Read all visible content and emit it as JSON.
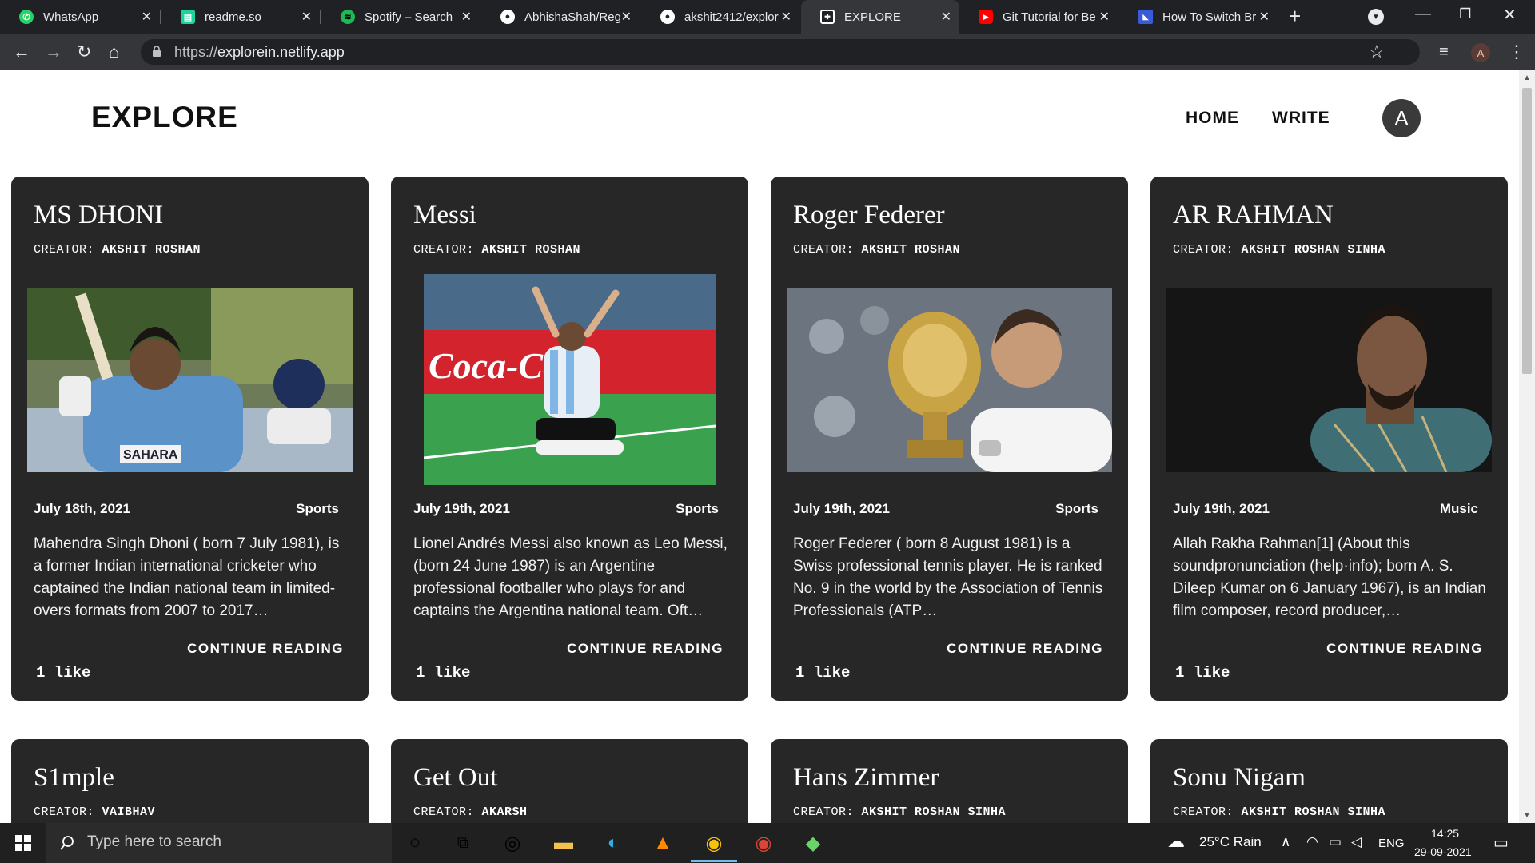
{
  "browser": {
    "tabs": [
      {
        "label": "WhatsApp",
        "icon": "whatsapp-icon",
        "color": "#25d366"
      },
      {
        "label": "readme.so",
        "icon": "readme-icon",
        "color": "#1fd29b"
      },
      {
        "label": "Spotify – Search",
        "icon": "spotify-icon",
        "color": "#1db954"
      },
      {
        "label": "AbhishaShah/Reg",
        "icon": "github-icon",
        "color": "#ffffff"
      },
      {
        "label": "akshit2412/explor",
        "icon": "github-icon",
        "color": "#ffffff"
      },
      {
        "label": "EXPLORE",
        "icon": "explore-icon",
        "color": "#ffffff"
      },
      {
        "label": "Git Tutorial for Be",
        "icon": "youtube-icon",
        "color": "#ff0000"
      },
      {
        "label": "How To Switch Br",
        "icon": "article-icon",
        "color": "#3a5bd9"
      }
    ],
    "url_scheme": "https://",
    "url_host": "explorein.netlify.app",
    "profile_initial": "A"
  },
  "site": {
    "brand": "EXPLORE",
    "nav": {
      "home": "HOME",
      "write": "WRITE"
    },
    "avatar_initial": "A"
  },
  "labels": {
    "creator_prefix": "CREATOR:",
    "continue": "CONTINUE READING"
  },
  "posts": [
    {
      "title": "MS DHONI",
      "creator": "AKSHIT ROSHAN",
      "date": "July 18th, 2021",
      "category": "Sports",
      "excerpt": "Mahendra Singh Dhoni ( born 7 July 1981), is a former Indian international cricketer who captained the Indian national team in limited-overs formats from 2007 to 2017…",
      "likes": "1 like",
      "jersey_text": "SAHARA"
    },
    {
      "title": "Messi",
      "creator": "AKSHIT ROSHAN",
      "date": "July 19th, 2021",
      "category": "Sports",
      "excerpt": "Lionel Andrés Messi also known as Leo Messi, (born 24 June 1987) is an Argentine professional footballer who plays for and captains the Argentina national team. Oft…",
      "likes": "1 like",
      "banner_text": "Coca-Cola"
    },
    {
      "title": "Roger Federer",
      "creator": "AKSHIT ROSHAN",
      "date": "July 19th, 2021",
      "category": "Sports",
      "excerpt": "Roger Federer ( born 8 August 1981) is a Swiss professional tennis player. He is ranked No. 9 in the world by the Association of Tennis Professionals (ATP…",
      "likes": "1 like"
    },
    {
      "title": "AR RAHMAN",
      "creator": "AKSHIT ROSHAN SINHA",
      "date": "July 19th, 2021",
      "category": "Music",
      "excerpt": "Allah Rakha Rahman[1] (About this soundpronunciation (help·info); born A. S. Dileep Kumar on 6 January 1967), is an Indian film composer, record producer,…",
      "likes": "1 like"
    },
    {
      "title": "S1mple",
      "creator": "VAIBHAV"
    },
    {
      "title": "Get Out",
      "creator": "AKARSH"
    },
    {
      "title": "Hans Zimmer",
      "creator": "AKSHIT ROSHAN SINHA"
    },
    {
      "title": "Sonu Nigam",
      "creator": "AKSHIT ROSHAN SINHA"
    }
  ],
  "taskbar": {
    "search_placeholder": "Type here to search",
    "weather": "25°C  Rain",
    "lang": "ENG",
    "time": "14:25",
    "date": "29-09-2021"
  }
}
